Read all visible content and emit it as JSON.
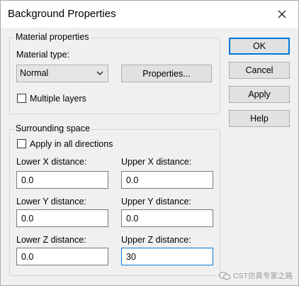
{
  "window": {
    "title": "Background Properties"
  },
  "material": {
    "group_label": "Material properties",
    "type_label": "Material type:",
    "type_value": "Normal",
    "properties_button": "Properties...",
    "multiple_layers_label": "Multiple layers"
  },
  "surrounding": {
    "group_label": "Surrounding space",
    "apply_all_label": "Apply in all directions",
    "lower_x_label": "Lower X distance:",
    "upper_x_label": "Upper X distance:",
    "lower_y_label": "Lower Y distance:",
    "upper_y_label": "Upper Y distance:",
    "lower_z_label": "Lower Z distance:",
    "upper_z_label": "Upper Z distance:",
    "lower_x": "0.0",
    "upper_x": "0.0",
    "lower_y": "0.0",
    "upper_y": "0.0",
    "lower_z": "0.0",
    "upper_z": "30"
  },
  "buttons": {
    "ok": "OK",
    "cancel": "Cancel",
    "apply": "Apply",
    "help": "Help"
  },
  "watermark": {
    "text": "CST仿真专家之路"
  }
}
